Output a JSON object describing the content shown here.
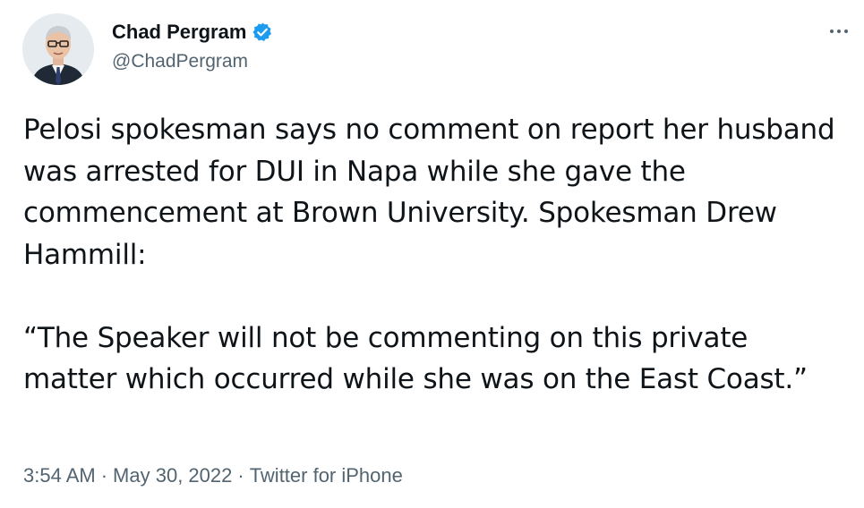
{
  "author": {
    "display_name": "Chad Pergram",
    "handle": "@ChadPergram",
    "verified": true
  },
  "tweet": {
    "paragraphs": [
      "Pelosi spokesman says no comment on report her husband was arrested for DUI in Napa while she gave the commencement at Brown University. Spokesman Drew Hammill:",
      "“The Speaker will not be commenting on this private matter which occurred while she was on the East Coast.”"
    ],
    "time": "3:54 AM",
    "date": "May 30, 2022",
    "source": "Twitter for iPhone",
    "separator": "·"
  },
  "icons": {
    "verified": "verified-badge-icon",
    "more": "more-options-icon"
  },
  "colors": {
    "text": "#0f1419",
    "secondary": "#536471",
    "verified_blue": "#1d9bf0"
  }
}
